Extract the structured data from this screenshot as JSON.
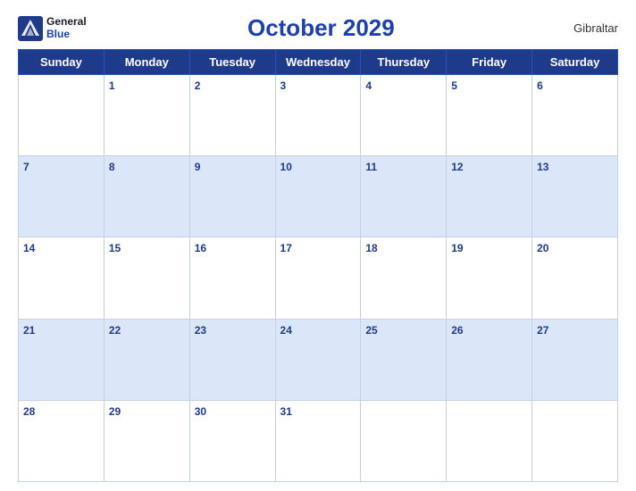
{
  "header": {
    "logo_general": "General",
    "logo_blue": "Blue",
    "title": "October 2029",
    "region": "Gibraltar"
  },
  "weekdays": [
    "Sunday",
    "Monday",
    "Tuesday",
    "Wednesday",
    "Thursday",
    "Friday",
    "Saturday"
  ],
  "weeks": [
    [
      null,
      1,
      2,
      3,
      4,
      5,
      6
    ],
    [
      7,
      8,
      9,
      10,
      11,
      12,
      13
    ],
    [
      14,
      15,
      16,
      17,
      18,
      19,
      20
    ],
    [
      21,
      22,
      23,
      24,
      25,
      26,
      27
    ],
    [
      28,
      29,
      30,
      31,
      null,
      null,
      null
    ]
  ]
}
